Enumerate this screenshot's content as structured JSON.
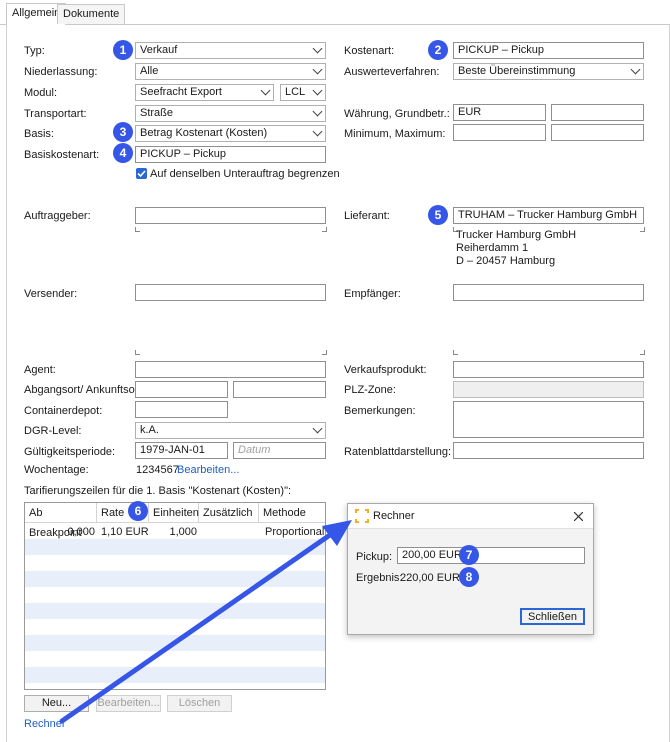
{
  "tabs": [
    "Allgemein",
    "Dokumente"
  ],
  "left": {
    "typ": {
      "label": "Typ:",
      "value": "Verkauf"
    },
    "niederlassung": {
      "label": "Niederlassung:",
      "value": "Alle"
    },
    "modul": {
      "label": "Modul:",
      "value": "Seefracht Export",
      "value2": "LCL"
    },
    "transportart": {
      "label": "Transportart:",
      "value": "Straße"
    },
    "basis": {
      "label": "Basis:",
      "value": "Betrag Kostenart (Kosten)"
    },
    "basiskostenart": {
      "label": "Basiskostenart:",
      "value": "PICKUP – Pickup"
    },
    "checkbox": {
      "label": "Auf denselben Unterauftrag begrenzen",
      "checked": true
    },
    "auftraggeber": {
      "label": "Auftraggeber:"
    },
    "versender": {
      "label": "Versender:"
    },
    "agent": {
      "label": "Agent:"
    },
    "abgangsort": {
      "label": "Abgangsort/ Ankunftsort:"
    },
    "containerdepot": {
      "label": "Containerdepot:"
    },
    "dgr": {
      "label": "DGR-Level:",
      "value": "k.A."
    },
    "gueltigkeit": {
      "label": "Gültigkeitsperiode:",
      "value": "1979-JAN-01",
      "placeholder": "Datum"
    },
    "wochentage": {
      "label": "Wochentage:",
      "value": "1234567",
      "link": "Bearbeiten..."
    }
  },
  "right": {
    "kostenart": {
      "label": "Kostenart:",
      "value": "PICKUP – Pickup"
    },
    "auswerteverfahren": {
      "label": "Auswerteverfahren:",
      "value": "Beste Übereinstimmung"
    },
    "waehrung": {
      "label": "Währung, Grundbetr.:",
      "value": "EUR"
    },
    "minmax": {
      "label": "Minimum, Maximum:"
    },
    "lieferant": {
      "label": "Lieferant:",
      "value": "TRUHAM – Trucker Hamburg GmbH",
      "address": [
        "Trucker Hamburg GmbH",
        "Reiherdamm 1",
        "D – 20457 Hamburg"
      ]
    },
    "empfaenger": {
      "label": "Empfänger:"
    },
    "verkaufsprodukt": {
      "label": "Verkaufsprodukt:"
    },
    "plz": {
      "label": "PLZ-Zone:"
    },
    "bemerkungen": {
      "label": "Bemerkungen:"
    },
    "ratenblatt": {
      "label": "Ratenblattdarstellung:"
    }
  },
  "tariff": {
    "title": "Tarifierungszeilen für die 1. Basis \"Kostenart (Kosten)\":",
    "columns": [
      "Ab Breakpoint",
      "Rate",
      "Einheiten",
      "Zusätzlich",
      "Methode"
    ],
    "rows": [
      [
        "0,000",
        "1,10 EUR",
        "1,000",
        "",
        "Proportional"
      ]
    ]
  },
  "buttons": {
    "neu": "Neu...",
    "bearbeiten": "Bearbeiten...",
    "loeschen": "Löschen"
  },
  "rechner_link": "Rechner",
  "dialog": {
    "title": "Rechner",
    "pickup_label": "Pickup:",
    "pickup_value": "200,00 EUR",
    "ergebnis_label": "Ergebnis:",
    "ergebnis_value": "220,00 EUR",
    "close_button": "Schließen"
  },
  "badges": [
    "1",
    "2",
    "3",
    "4",
    "5",
    "6",
    "7",
    "8"
  ],
  "colors": {
    "badge": "#3556e6",
    "arrow": "#3556e6",
    "stripe": "#e8effa"
  }
}
